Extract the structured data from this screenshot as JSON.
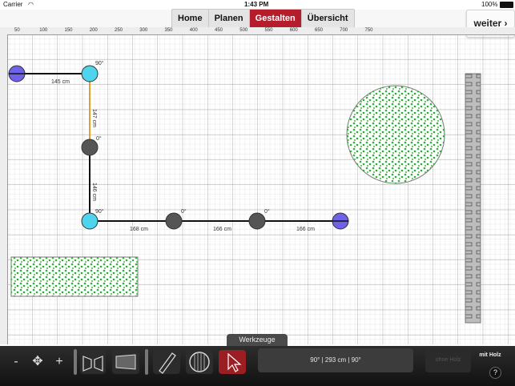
{
  "statusbar": {
    "carrier": "Carrier",
    "time": "1:43 PM",
    "battery": "100%"
  },
  "nav": {
    "tabs": [
      {
        "label": "Home"
      },
      {
        "label": "Planen"
      },
      {
        "label": "Gestalten",
        "active": true
      },
      {
        "label": "Übersicht"
      }
    ],
    "next_label": "weiter ›"
  },
  "ruler": {
    "top_ticks": [
      "50",
      "100",
      "150",
      "200",
      "250",
      "300",
      "350",
      "400",
      "450",
      "500",
      "550",
      "600",
      "650",
      "700",
      "750"
    ]
  },
  "drawing": {
    "segments": [
      "145 cm",
      "147 cm",
      "146 cm",
      "168 cm",
      "166 cm",
      "166 cm"
    ],
    "angles": [
      "90°",
      "0°",
      "90°",
      "0°",
      "0°"
    ]
  },
  "toolbar": {
    "title": "Werkzeuge",
    "minus": "-",
    "plus": "+",
    "info": "90° | 293 cm | 90°",
    "ohne_holz": "ohne Holz",
    "mit_holz": "mit Holz",
    "help": "?"
  },
  "colors": {
    "accent": "#b51d2d",
    "endpoint": "#6e62e8",
    "joint": "#4fd4ee",
    "node": "#555555",
    "plants": "#2fae3a"
  }
}
